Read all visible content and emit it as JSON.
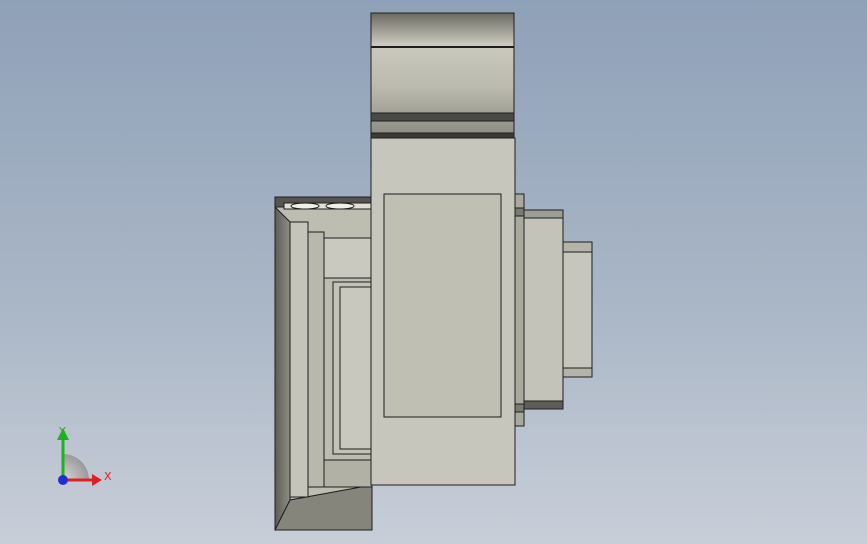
{
  "viewport": {
    "background_top": "#8fa1b8",
    "background_bottom": "#c8ced8"
  },
  "model": {
    "description_icon": "cad-side-view-part",
    "fill_light": "#c6c6bc",
    "fill_mid": "#a9a99e",
    "fill_dark": "#6f6f66",
    "edge": "#1e1e1e"
  },
  "triad": {
    "x_label": "X",
    "y_label": "Y",
    "x_color": "#e02020",
    "y_color": "#20b020",
    "origin_color": "#2030d0"
  }
}
